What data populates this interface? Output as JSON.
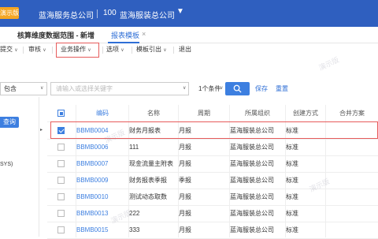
{
  "header": {
    "badge": "演示版",
    "org_name": "蓝海服务总公司",
    "org_code": "100",
    "company_name": "蓝海服装总公司",
    "dropdown_icon": "caret-down-icon"
  },
  "tabs": {
    "scope_tab": "核算维度数据范围 - 新增",
    "template_tab": "报表模板",
    "close_icon": "×"
  },
  "toolbar": {
    "submit": "提交",
    "audit": "审核",
    "business_ops": "业务操作",
    "options": "选项",
    "template_export": "模板引出",
    "exit": "退出"
  },
  "filter": {
    "operator": "包含",
    "placeholder": "请输入或选择关键字",
    "condition_count": "1个条件",
    "save": "保存",
    "reset": "重置"
  },
  "left_panel": {
    "query_button": "查询",
    "partial_text": "SYS)"
  },
  "table": {
    "columns": [
      "编码",
      "名称",
      "周期",
      "所属组织",
      "创建方式",
      "合并方案"
    ],
    "rows": [
      {
        "checked": true,
        "code": "BBMB0004",
        "name": "财务月报表",
        "period": "月报",
        "org": "蓝海服装总公司",
        "mode": "标准",
        "scheme": ""
      },
      {
        "checked": false,
        "code": "BBMB0006",
        "name": "111",
        "period": "月报",
        "org": "蓝海服装总公司",
        "mode": "标准",
        "scheme": ""
      },
      {
        "checked": false,
        "code": "BBMB0007",
        "name": "现金流量主附表",
        "period": "月报",
        "org": "蓝海服装总公司",
        "mode": "标准",
        "scheme": ""
      },
      {
        "checked": false,
        "code": "BBMB0009",
        "name": "财务报表季报",
        "period": "季报",
        "org": "蓝海服装总公司",
        "mode": "标准",
        "scheme": ""
      },
      {
        "checked": false,
        "code": "BBMB0010",
        "name": "测试动态取数",
        "period": "月报",
        "org": "蓝海服装总公司",
        "mode": "标准",
        "scheme": ""
      },
      {
        "checked": false,
        "code": "BBMB0013",
        "name": "222",
        "period": "月报",
        "org": "蓝海服装总公司",
        "mode": "标准",
        "scheme": ""
      },
      {
        "checked": false,
        "code": "BBMB0015",
        "name": "333",
        "period": "月报",
        "org": "蓝海服装总公司",
        "mode": "标准",
        "scheme": ""
      }
    ]
  },
  "watermark": "演示版",
  "colors": {
    "header_bg": "#2f5fbf",
    "accent": "#3d7fe0",
    "badge": "#f5a623",
    "highlight_border": "#e65c5c"
  }
}
